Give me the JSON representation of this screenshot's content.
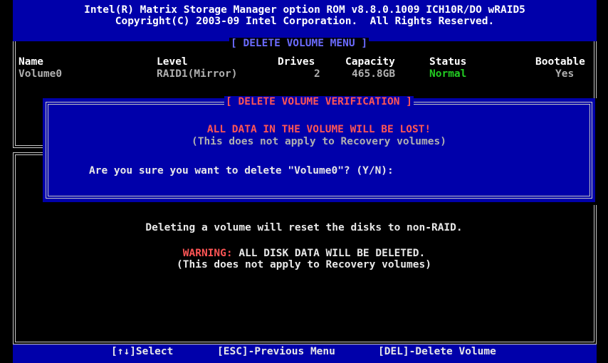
{
  "header": {
    "line1": "Intel(R) Matrix Storage Manager option ROM v8.8.0.1009 ICH10R/DO wRAID5",
    "line2": "Copyright(C) 2003-09 Intel Corporation.  All Rights Reserved."
  },
  "menu_title": "[ DELETE VOLUME MENU ]",
  "table": {
    "columns": [
      "Name",
      "Level",
      "Drives",
      "Capacity",
      "Status",
      "Bootable"
    ],
    "rows": [
      {
        "name": "Volume0",
        "level": "RAID1(Mirror)",
        "drives": "2",
        "capacity": "465.8GB",
        "status": "Normal",
        "bootable": "Yes"
      }
    ]
  },
  "dialog": {
    "title": "[ DELETE VOLUME VERIFICATION ]",
    "warning": "ALL DATA IN THE VOLUME WILL BE LOST!",
    "note": "(This does not apply to Recovery volumes)",
    "prompt": "Are you sure you want to delete \"Volume0\"? (Y/N):"
  },
  "help": {
    "line1": "Deleting a volume will reset the disks to non-RAID.",
    "warning_label": "WARNING:",
    "warning_text": " ALL DISK DATA WILL BE DELETED.",
    "line3": "(This does not apply to Recovery volumes)"
  },
  "footer": {
    "select": "[↑↓]Select",
    "esc": "[ESC]-Previous Menu",
    "del": "[DEL]-Delete Volume"
  },
  "colors": {
    "blue": "#0000aa",
    "text": "#e8e8e8",
    "gray": "#b0b0b0",
    "red": "#ff5555",
    "green": "#22cc22",
    "white": "#ffffff"
  }
}
